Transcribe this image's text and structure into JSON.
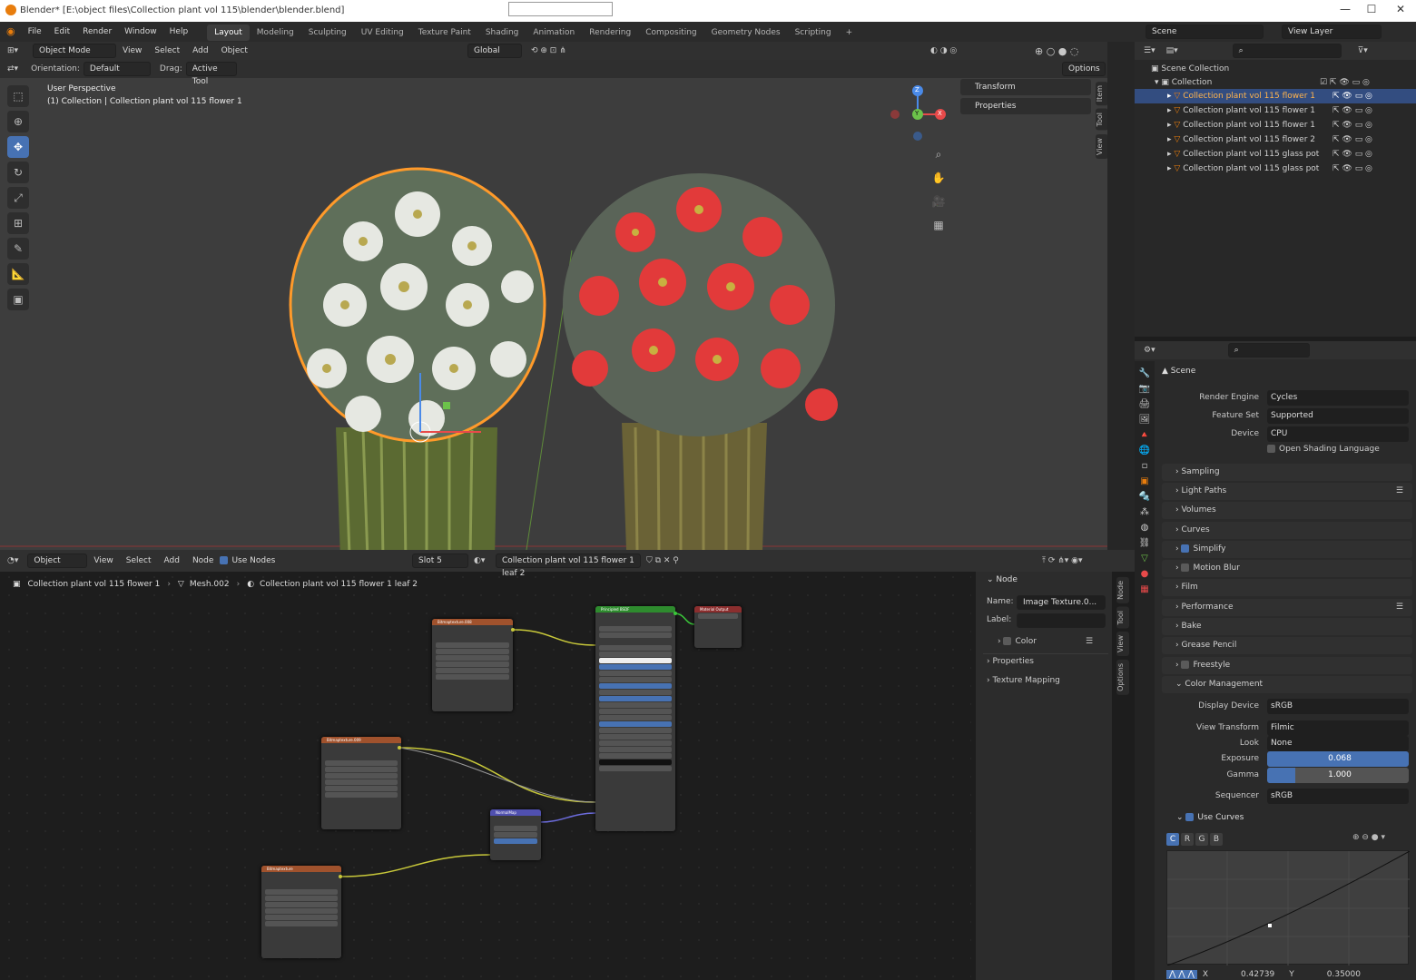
{
  "titlebar": {
    "title": "Blender* [E:\\object files\\Collection plant vol 115\\blender\\blender.blend]",
    "minimize": "—",
    "maximize": "☐",
    "close": "✕"
  },
  "menu": [
    "File",
    "Edit",
    "Render",
    "Window",
    "Help"
  ],
  "workspaces": [
    "Layout",
    "Modeling",
    "Sculpting",
    "UV Editing",
    "Texture Paint",
    "Shading",
    "Animation",
    "Rendering",
    "Compositing",
    "Geometry Nodes",
    "Scripting",
    "+"
  ],
  "scene": {
    "label": "Scene",
    "view_layer": "View Layer"
  },
  "viewport": {
    "mode": "Object Mode",
    "menus": [
      "View",
      "Select",
      "Add",
      "Object"
    ],
    "transform": "Global",
    "orientation_label": "Orientation:",
    "orientation": "Default",
    "drag_label": "Drag:",
    "drag": "Active Tool",
    "options": "Options",
    "overlay_title": "User Perspective",
    "overlay_sub": "(1) Collection | Collection plant vol 115 flower 1",
    "npanel": [
      "Transform",
      "Properties"
    ],
    "tabs": [
      "Item",
      "Tool",
      "View"
    ],
    "gizmo": {
      "z": "Z",
      "y": "Y",
      "x": "X"
    }
  },
  "outliner": {
    "root": "Scene Collection",
    "collection": "Collection",
    "items": [
      "Collection plant vol 115 flower 1",
      "Collection plant vol 115 flower 1",
      "Collection plant vol 115 flower 1",
      "Collection plant vol 115 flower 2",
      "Collection plant vol 115 glass pot",
      "Collection plant vol 115 glass pot"
    ]
  },
  "properties": {
    "context": "Scene",
    "render_engine_label": "Render Engine",
    "render_engine": "Cycles",
    "feature_set_label": "Feature Set",
    "feature_set": "Supported",
    "device_label": "Device",
    "device": "CPU",
    "osl": "Open Shading Language",
    "panels": [
      "Sampling",
      "Light Paths",
      "Volumes",
      "Curves",
      "Simplify",
      "Motion Blur",
      "Film",
      "Performance",
      "Bake",
      "Grease Pencil",
      "Freestyle",
      "Color Management"
    ],
    "display_device_label": "Display Device",
    "display_device": "sRGB",
    "view_transform_label": "View Transform",
    "view_transform": "Filmic",
    "look_label": "Look",
    "look": "None",
    "exposure_label": "Exposure",
    "exposure": "0.068",
    "gamma_label": "Gamma",
    "gamma": "1.000",
    "sequencer_label": "Sequencer",
    "sequencer": "sRGB",
    "use_curves": "Use Curves",
    "channels": [
      "C",
      "R",
      "G",
      "B"
    ],
    "x_label": "X",
    "x_value": "0.42739",
    "y_label": "Y",
    "y_value": "0.35000"
  },
  "nodeeditor": {
    "type": "Object",
    "menus": [
      "View",
      "Select",
      "Add",
      "Node"
    ],
    "use_nodes": "Use Nodes",
    "slot": "Slot 5",
    "material": "Collection plant vol 115 flower 1 leaf 2",
    "breadcrumb": [
      "Collection plant vol 115 flower 1",
      "Mesh.002",
      "Collection plant vol 115 flower 1 leaf 2"
    ],
    "side": {
      "node_header": "Node",
      "name_label": "Name:",
      "name_value": "Image Texture.0...",
      "label_label": "Label:",
      "color": "Color",
      "properties": "Properties",
      "texture_mapping": "Texture Mapping",
      "tabs": [
        "Node",
        "Tool",
        "View",
        "Options"
      ]
    },
    "nodes": {
      "bsdf": "Principled BSDF",
      "output": "Material Output",
      "tex1": "Bitmaptexture.008",
      "tex2": "Bitmaptexture.009",
      "tex3": "Bitmaptexture",
      "normal": "NormalMap"
    }
  },
  "colors": {
    "accent": "#4772b3",
    "selected_text": "#ffb44d",
    "node_texture": "#a0522d",
    "node_shader": "#2e8b2e",
    "node_output": "#8b2e2e"
  }
}
